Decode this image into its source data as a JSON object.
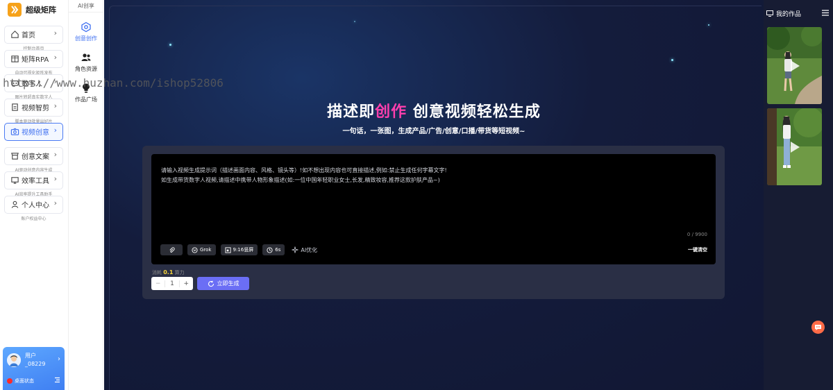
{
  "app": {
    "name": "超级矩阵"
  },
  "sidebar": {
    "items": [
      {
        "label": "首页",
        "sub": "控制台首页"
      },
      {
        "label": "矩阵RPA",
        "sub": "自动可视化矩阵发布"
      },
      {
        "label": "数字人",
        "sub": "图片转超真实数字人"
      },
      {
        "label": "视频智剪",
        "sub": "脚本驱动批量出好片"
      },
      {
        "label": "视频创意",
        "sub": ""
      },
      {
        "label": "创意文案",
        "sub": "AI驱动创意内容生成"
      },
      {
        "label": "效率工具",
        "sub": "AI效率提升工具助手"
      },
      {
        "label": "个人中心",
        "sub": "账户权益中心"
      }
    ],
    "active_index": 4,
    "user": {
      "label": "用户",
      "name": "_08229",
      "status": "桌面状态"
    }
  },
  "subnav": {
    "title": "AI创享",
    "items": [
      {
        "label": "创意创作"
      },
      {
        "label": "角色资源"
      },
      {
        "label": "作品广场"
      }
    ]
  },
  "main": {
    "title_pre": "描述即",
    "title_accent": "创作",
    "title_post": " 创意视频轻松生成",
    "subtitle": "一句话，一张图，生成产品/广告/创意/口播/带货等短视频~",
    "prompt_line1": "请输入视频生成提示词（描述画面内容、风格、镜头等）!如不想出现内容也可直接描述,例如:禁止生成任何字幕文字!",
    "prompt_line2": "如生成带货数字人视频,请描述中携带人物形象描述(如:一位中国年轻职业女士,长发,精致妆容,推荐这款护肤产品~)",
    "counter": "0 / 9900",
    "chips": {
      "model": "Grok",
      "ratio": "9:16竖屏",
      "duration": "6s"
    },
    "ai_optimize": "AI优化",
    "clear": "一键清空",
    "cost_label": "消耗",
    "cost_value": "0.1",
    "cost_unit": "算力",
    "quantity": "1",
    "quantity_minus": "−",
    "quantity_plus": "+",
    "generate": "立即生成"
  },
  "works": {
    "title": "我的作品"
  },
  "watermark": "https://www.huzhan.com/ishop52806",
  "colors": {
    "accent": "#3b6df0",
    "title_accent": "#ff3fae",
    "generate": "#6b6ef5",
    "logo": "#f6a21a"
  }
}
